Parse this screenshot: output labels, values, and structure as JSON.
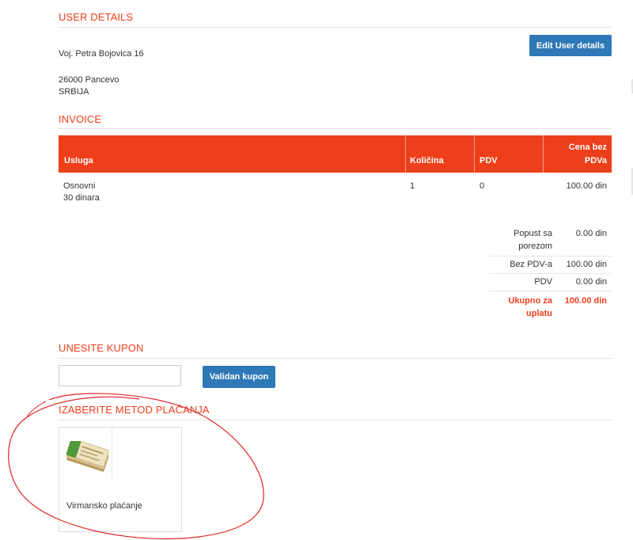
{
  "user_details": {
    "title": "USER DETAILS",
    "edit_button": "Edit User details",
    "address_line1": "Voj. Petra Bojovica 16",
    "address_line2": "26000 Pancevo",
    "address_line3": "SRBIJA"
  },
  "invoice": {
    "title": "INVOICE",
    "columns": {
      "service": "Usluga",
      "quantity": "Količina",
      "vat": "PDV",
      "price_line1": "Cena bez",
      "price_line2": "PDVa"
    },
    "rows": [
      {
        "service_line1": "Osnovni",
        "service_line2": "30 dinara",
        "quantity": "1",
        "vat": "0",
        "price": "100.00 din"
      }
    ],
    "summary": {
      "discount_label_line1": "Popust sa",
      "discount_label_line2": "porezom",
      "discount_value": "0.00 din",
      "net_label": "Bez PDV-a",
      "net_value": "100.00 din",
      "vat_label": "PDV",
      "vat_value": "0.00 din",
      "total_label_line1": "Ukupno za",
      "total_label_line2": "uplatu",
      "total_value": "100.00 din"
    }
  },
  "coupon": {
    "title": "UNESITE KUPON",
    "input_value": "",
    "button": "Validan kupon"
  },
  "payment": {
    "title": "IZABERITE METOD PLAĆANJA",
    "methods": [
      {
        "label": "Virmansko plaćanje",
        "icon": "bank-transfer-card-icon"
      }
    ]
  },
  "colors": {
    "accent": "#ee3f1b",
    "button": "#2f78b7",
    "annotation": "#e0262b"
  }
}
